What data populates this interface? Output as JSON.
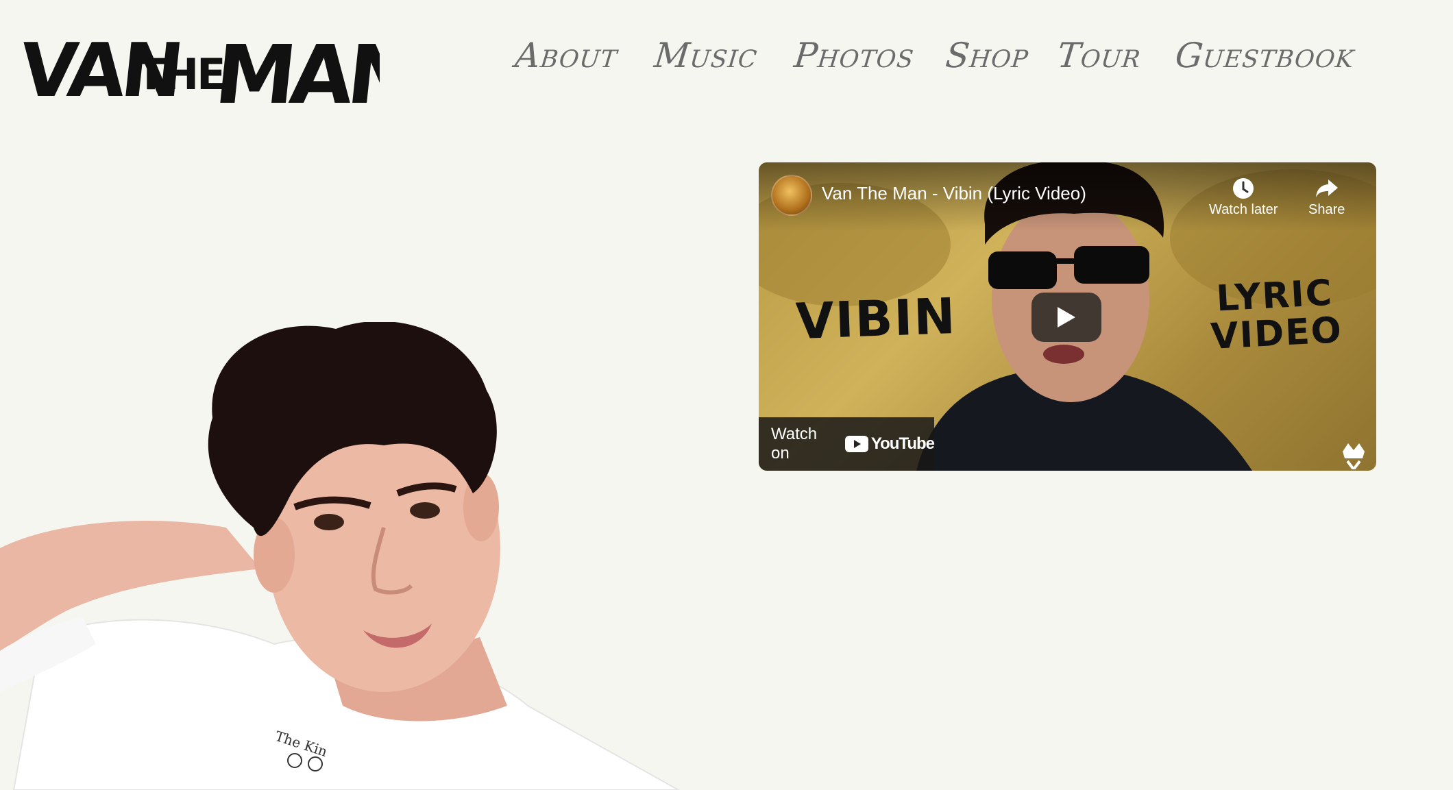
{
  "site": {
    "logo_text": "VAN THE MAN"
  },
  "nav": {
    "items": [
      {
        "label": "About"
      },
      {
        "label": "Music"
      },
      {
        "label": "Photos"
      },
      {
        "label": "Shop"
      },
      {
        "label": "Tour"
      },
      {
        "label": "Guestbook"
      }
    ]
  },
  "video": {
    "title": "Van The Man - Vibin (Lyric Video)",
    "watch_later_label": "Watch later",
    "share_label": "Share",
    "watch_on_label": "Watch on",
    "youtube_label": "YouTube",
    "thumbnail_left_text": "VIBIN",
    "thumbnail_right_line1": "LYRIC",
    "thumbnail_right_line2": "VIDEO"
  },
  "colors": {
    "background": "#f6f6f1",
    "nav_text": "#6b6b6b",
    "video_gold": "#c2a24e"
  }
}
